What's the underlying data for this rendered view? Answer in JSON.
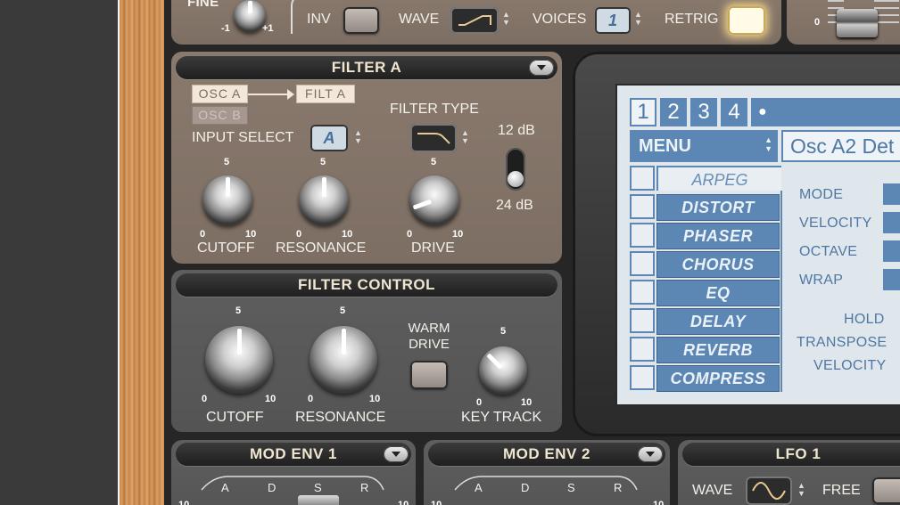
{
  "top_strip": {
    "fine_label": "FINE",
    "fine_min": "-1",
    "fine_max": "+1",
    "inv_label": "INV",
    "wave_label": "WAVE",
    "voices_label": "VOICES",
    "voices_value": "1",
    "retrig_label": "RETRIG",
    "slider_zero": "0"
  },
  "filter_a": {
    "title": "FILTER A",
    "osc_a": "OSC A",
    "osc_b": "OSC B",
    "filt_a": "FILT A",
    "input_select_label": "INPUT SELECT",
    "input_select_value": "A",
    "filter_type_label": "FILTER TYPE",
    "slope_12": "12 dB",
    "slope_24": "24 dB",
    "knobs": [
      {
        "label": "CUTOFF",
        "min": "0",
        "mid": "5",
        "max": "10",
        "value": 5.0
      },
      {
        "label": "RESONANCE",
        "min": "0",
        "mid": "5",
        "max": "10",
        "value": 5.0
      },
      {
        "label": "DRIVE",
        "min": "0",
        "mid": "5",
        "max": "10",
        "value": 1.2
      }
    ]
  },
  "filter_control": {
    "title": "FILTER CONTROL",
    "warm_drive_label": "WARM DRIVE",
    "knobs": [
      {
        "label": "CUTOFF",
        "min": "0",
        "mid": "5",
        "max": "10",
        "value": 5.0
      },
      {
        "label": "RESONANCE",
        "min": "0",
        "mid": "5",
        "max": "10",
        "value": 5.0
      },
      {
        "label": "KEY TRACK",
        "min": "0",
        "mid": "5",
        "max": "10",
        "value": 3.5
      }
    ]
  },
  "display": {
    "tabs": [
      "1",
      "2",
      "3",
      "4",
      "●"
    ],
    "menu_label": "MENU",
    "preset_text": "Osc A2 Det",
    "fx_items": [
      "ARPEG",
      "DISTORT",
      "PHASER",
      "CHORUS",
      "EQ",
      "DELAY",
      "REVERB",
      "COMPRESS"
    ],
    "param_labels": [
      "MODE",
      "VELOCITY",
      "OCTAVE",
      "WRAP",
      "HOLD",
      "TRANSPOSE",
      "VELOCITY"
    ]
  },
  "bottom": {
    "mod_env_1": "MOD ENV 1",
    "mod_env_2": "MOD ENV 2",
    "lfo_1": "LFO 1",
    "adsr": [
      "A",
      "D",
      "S",
      "R"
    ],
    "lfo_wave_label": "WAVE",
    "lfo_free_label": "FREE",
    "env_val": "10"
  },
  "colors": {
    "accent_blue": "#5c86b4",
    "panel_brown": "#84756a",
    "panel_gray": "#595959",
    "title_text": "#f0e6d0"
  }
}
